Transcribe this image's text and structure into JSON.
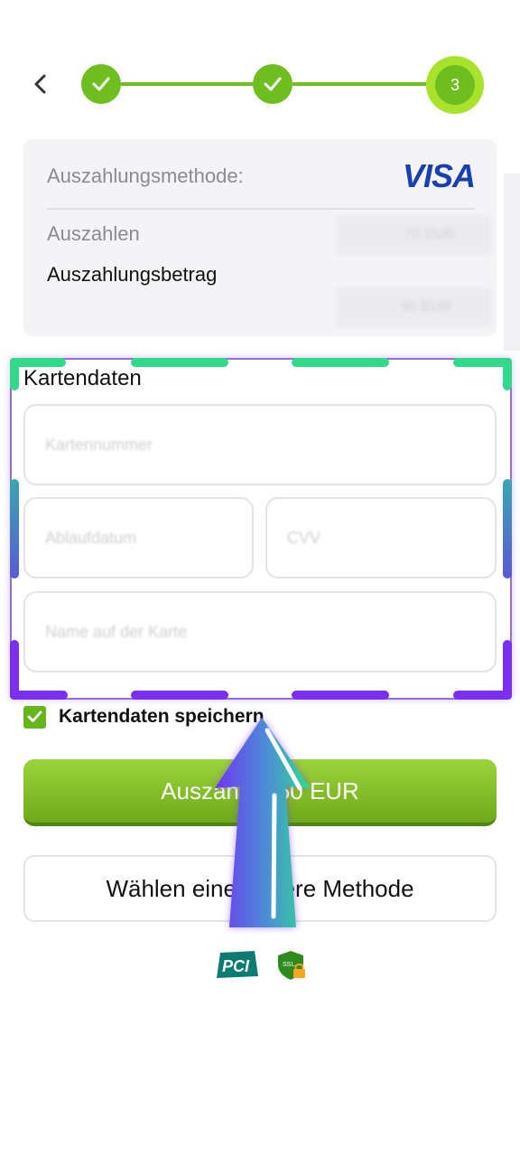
{
  "stepper": {
    "current_step": "3"
  },
  "summary": {
    "method_label": "Auszahlungsmethode:",
    "method_brand": "VISA",
    "payout_label": "Auszahlen",
    "payout_value": "70 EUR",
    "amount_label": "Auszahlungsbetrag",
    "amount_value": "60 EUR"
  },
  "card_section": {
    "title": "Kartendaten",
    "card_number_placeholder": "Kartennummer",
    "expiry_placeholder": "Ablaufdatum",
    "cvv_placeholder": "CVV",
    "holder_placeholder": "Name auf der Karte"
  },
  "save_card": {
    "label": "Kartendaten speichern",
    "checked": true
  },
  "buttons": {
    "payout": "Auszahlen 60 EUR",
    "other_method": "Wählen eine andere Methode"
  },
  "badges": {
    "pci": "PCI",
    "ssl": "SSL"
  },
  "colors": {
    "accent_green": "#6dbe1e",
    "visa_blue": "#1a3fb0",
    "highlight_purple": "#7b2ff0",
    "highlight_teal": "#2edc8c"
  }
}
